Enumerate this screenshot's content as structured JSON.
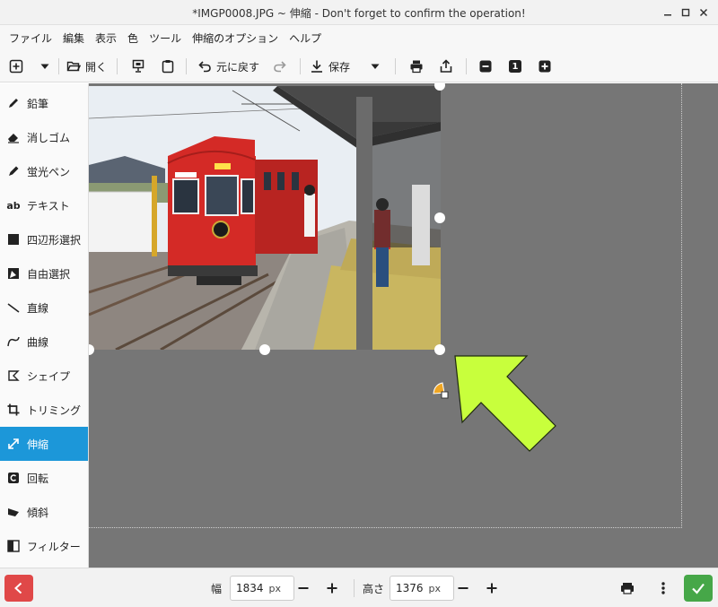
{
  "window": {
    "title": "*IMGP0008.JPG ~ 伸縮 - Don't forget to confirm the operation!"
  },
  "menu": [
    "ファイル",
    "編集",
    "表示",
    "色",
    "ツール",
    "伸縮のオプション",
    "ヘルプ"
  ],
  "toolbar": {
    "open_label": "開く",
    "undo_label": "元に戻す",
    "save_label": "保存"
  },
  "tools": [
    {
      "label": "鉛筆",
      "icon": "pencil-icon",
      "active": false
    },
    {
      "label": "消しゴム",
      "icon": "eraser-icon",
      "active": false
    },
    {
      "label": "蛍光ペン",
      "icon": "highlighter-icon",
      "active": false
    },
    {
      "label": "テキスト",
      "icon": "text-icon",
      "active": false
    },
    {
      "label": "四辺形選択",
      "icon": "rect-select-icon",
      "active": false
    },
    {
      "label": "自由選択",
      "icon": "free-select-icon",
      "active": false
    },
    {
      "label": "直線",
      "icon": "line-icon",
      "active": false
    },
    {
      "label": "曲線",
      "icon": "curve-icon",
      "active": false
    },
    {
      "label": "シェイプ",
      "icon": "shape-icon",
      "active": false
    },
    {
      "label": "トリミング",
      "icon": "crop-icon",
      "active": false
    },
    {
      "label": "伸縮",
      "icon": "scale-icon",
      "active": true
    },
    {
      "label": "回転",
      "icon": "rotate-icon",
      "active": false
    },
    {
      "label": "傾斜",
      "icon": "skew-icon",
      "active": false
    },
    {
      "label": "フィルター",
      "icon": "filter-icon",
      "active": false
    }
  ],
  "tool_icons": {
    "text_glyph": "ab"
  },
  "zoom_label": "1",
  "bottom": {
    "width_label": "幅",
    "width_value": "1834",
    "height_label": "高さ",
    "height_value": "1376",
    "unit": "px"
  },
  "colors": {
    "accent": "#1c97d9",
    "cancel": "#e04848",
    "confirm": "#46a748",
    "canvas": "#767676",
    "arrow": "#c8ff3c",
    "photo_train_red": "#d42a26"
  }
}
